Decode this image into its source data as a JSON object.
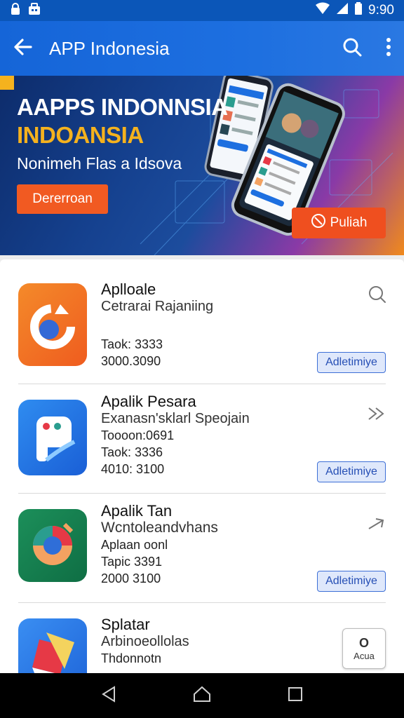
{
  "status": {
    "time": "9:90"
  },
  "appbar": {
    "title": "APP Indonesia"
  },
  "banner": {
    "headline1": "AAPPS INDONNSIA",
    "headline2": "INDOANSIA",
    "subtitle": "Nonimeh Flas a Idsova",
    "cta_label": "Dererroan",
    "secondary_label": "Puliah"
  },
  "apps": [
    {
      "name": "Aplloale",
      "line1": "Cetrarai Rajaniing",
      "line2": "Taok: 3333",
      "line3": "3000.3090",
      "button": "Adletimiye"
    },
    {
      "name": "Apalik Pesara",
      "line1": "Exanasn'sklarl Speojain",
      "line2": "Toooon:0691",
      "line3": "Taok: 3336",
      "line4": "4010: 3100",
      "button": "Adletimiye"
    },
    {
      "name": "Apalik Tan",
      "line1": "Wcntoleandvhans",
      "line2": "Aplaan oonl",
      "line3": "Tapic 3391",
      "line4": "2000 3100",
      "button": "Adletimiye"
    },
    {
      "name": "Splatar",
      "line1": "Arbinoeollolas",
      "line2": "Thdonnotn",
      "button_top": "O",
      "button": "Acua"
    }
  ],
  "colors": {
    "status": "#0b56b8",
    "appbar": "#1565d8",
    "accent": "#f15a22",
    "install_border": "#3d6fd6"
  }
}
